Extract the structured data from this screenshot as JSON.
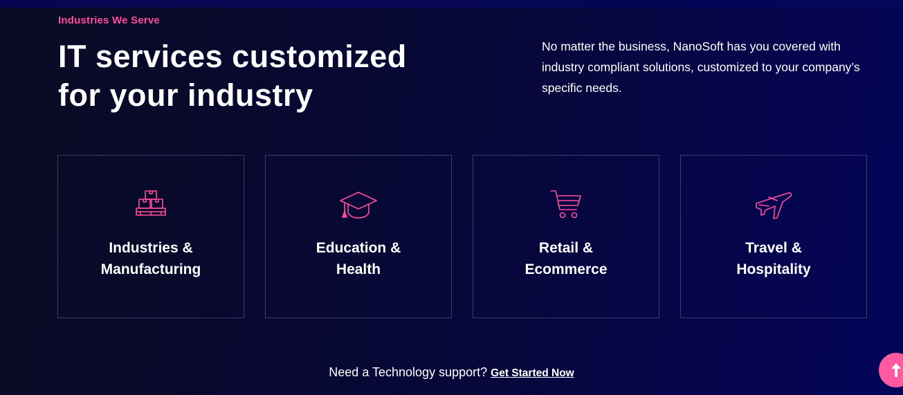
{
  "section": {
    "eyebrow": "Industries We Serve",
    "headline": "IT services customized for your industry",
    "intro": "No matter the business, NanoSoft has you covered with industry compliant solutions, customized to your company’s specific needs."
  },
  "cards": [
    {
      "title": "Industries &\nManufacturing",
      "icon": "boxes-pallet-icon"
    },
    {
      "title": "Education &\nHealth",
      "icon": "graduation-cap-icon"
    },
    {
      "title": "Retail &\nEcommerce",
      "icon": "shopping-cart-icon"
    },
    {
      "title": "Travel &\nHospitality",
      "icon": "airplane-icon"
    }
  ],
  "cta": {
    "text": "Need a Technology support?",
    "link_label": "Get Started Now"
  },
  "scroll_top": {
    "icon": "arrow-up-icon"
  },
  "colors": {
    "accent": "#ff4f9a",
    "background": "#07073a",
    "card_border": "#3a3d6e"
  }
}
